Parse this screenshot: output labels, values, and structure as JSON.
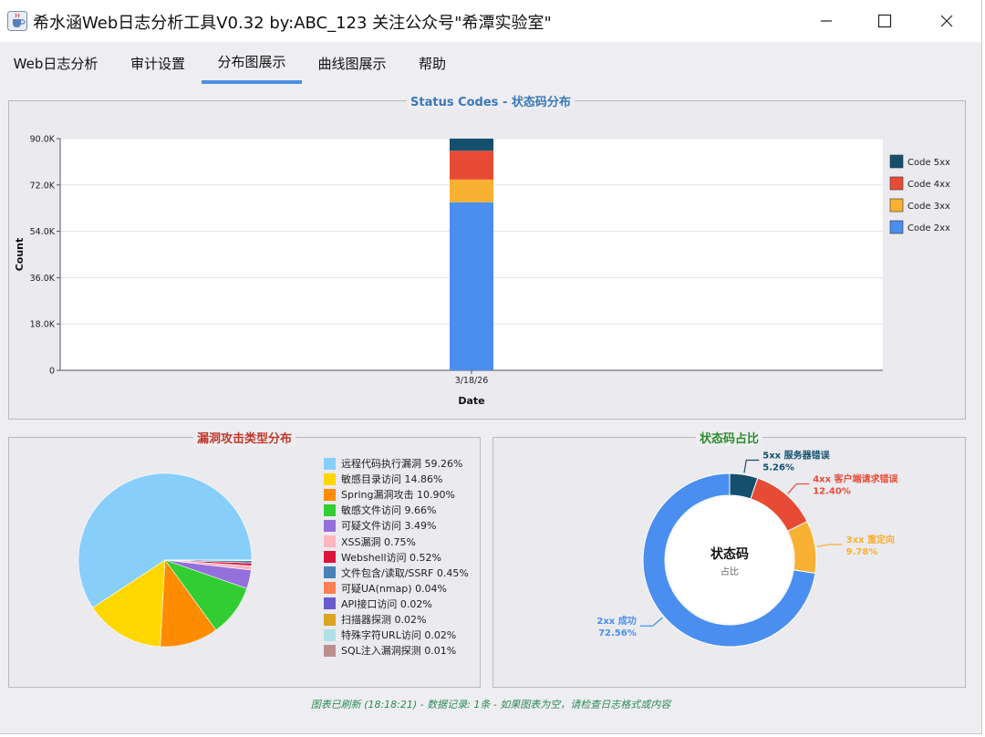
{
  "window": {
    "title": "希水涵Web日志分析工具V0.32 by:ABC_123 关注公众号\"希潭实验室\"",
    "icon": "java-cup-icon"
  },
  "menu": {
    "tabs": [
      {
        "label": "Web日志分析",
        "active": false
      },
      {
        "label": "审计设置",
        "active": false
      },
      {
        "label": "分布图展示",
        "active": true
      },
      {
        "label": "曲线图展示",
        "active": false
      },
      {
        "label": "帮助",
        "active": false
      }
    ]
  },
  "status_panel": {
    "title": "Status Codes - 状态码分布",
    "title_color": "#3a78b8"
  },
  "vuln_panel": {
    "title": "漏洞攻击类型分布",
    "title_color": "#c0392b"
  },
  "donut_panel": {
    "title": "状态码占比",
    "title_color": "#2e8b2e",
    "center_title": "状态码",
    "center_sub": "占比"
  },
  "status_bar": {
    "text": "图表已刷新 (18:18:21) - 数据记录: 1条 - 如果图表为空，请检查日志格式或内容"
  },
  "chart_data": [
    {
      "type": "bar",
      "stacked": true,
      "categories": [
        "3/18/26"
      ],
      "xlabel": "Date",
      "ylabel": "Count",
      "ylim": [
        0,
        90000
      ],
      "yticks": [
        "0",
        "18.0K",
        "36.0K",
        "54.0K",
        "72.0K",
        "90.0K"
      ],
      "grid": true,
      "legend_position": "right",
      "series": [
        {
          "name": "Code 2xx",
          "values": [
            65300
          ],
          "color": "#4a8ff0"
        },
        {
          "name": "Code 3xx",
          "values": [
            8800
          ],
          "color": "#f8b133"
        },
        {
          "name": "Code 4xx",
          "values": [
            11200
          ],
          "color": "#e84b35"
        },
        {
          "name": "Code 5xx",
          "values": [
            4700
          ],
          "color": "#14506e"
        }
      ]
    },
    {
      "type": "pie",
      "legend_position": "right",
      "slices": [
        {
          "label": "远程代码执行漏洞 59.26%",
          "value": 59.26,
          "color": "#87cefa"
        },
        {
          "label": "敏感目录访问 14.86%",
          "value": 14.86,
          "color": "#ffd700"
        },
        {
          "label": "Spring漏洞攻击 10.90%",
          "value": 10.9,
          "color": "#ff8c00"
        },
        {
          "label": "敏感文件访问 9.66%",
          "value": 9.66,
          "color": "#32cd32"
        },
        {
          "label": "可疑文件访问 3.49%",
          "value": 3.49,
          "color": "#9370db"
        },
        {
          "label": "XSS漏洞 0.75%",
          "value": 0.75,
          "color": "#ffb6c1"
        },
        {
          "label": "Webshell访问 0.52%",
          "value": 0.52,
          "color": "#dc143c"
        },
        {
          "label": "文件包含/读取/SSRF 0.45%",
          "value": 0.45,
          "color": "#4682b4"
        },
        {
          "label": "可疑UA(nmap) 0.04%",
          "value": 0.04,
          "color": "#ff7f50"
        },
        {
          "label": "API接口访问 0.02%",
          "value": 0.02,
          "color": "#6a5acd"
        },
        {
          "label": "扫描器探测 0.02%",
          "value": 0.02,
          "color": "#daa520"
        },
        {
          "label": "特殊字符URL访问 0.02%",
          "value": 0.02,
          "color": "#b0e0e6"
        },
        {
          "label": "SQL注入漏洞探测 0.01%",
          "value": 0.01,
          "color": "#bc8f8f"
        }
      ]
    },
    {
      "type": "pie",
      "donut": true,
      "slices": [
        {
          "label": "5xx 服务器错误",
          "pct": "5.26%",
          "value": 5.26,
          "color": "#14506e"
        },
        {
          "label": "4xx 客户端请求错误",
          "pct": "12.40%",
          "value": 12.4,
          "color": "#e84b35"
        },
        {
          "label": "3xx 重定向",
          "pct": "9.78%",
          "value": 9.78,
          "color": "#f8b133"
        },
        {
          "label": "2xx 成功",
          "pct": "72.56%",
          "value": 72.56,
          "color": "#4a8ff0"
        }
      ]
    }
  ]
}
